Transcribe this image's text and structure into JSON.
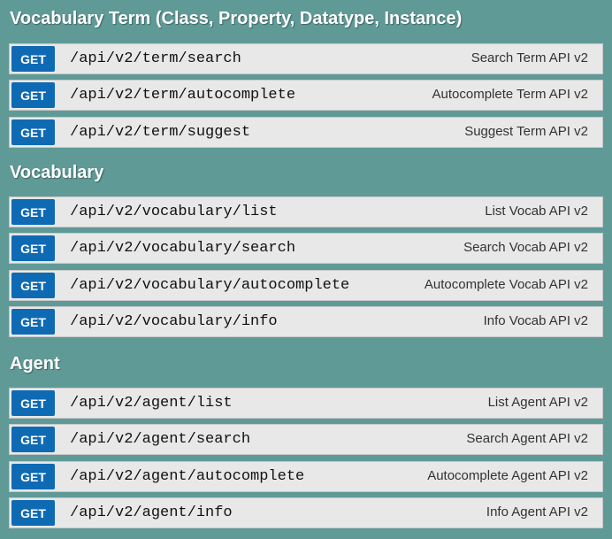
{
  "sections": [
    {
      "title": "Vocabulary Term (Class, Property, Datatype, Instance)",
      "operations": [
        {
          "method": "GET",
          "path": "/api/v2/term/search",
          "summary": "Search Term API v2"
        },
        {
          "method": "GET",
          "path": "/api/v2/term/autocomplete",
          "summary": "Autocomplete Term API v2"
        },
        {
          "method": "GET",
          "path": "/api/v2/term/suggest",
          "summary": "Suggest Term API v2"
        }
      ]
    },
    {
      "title": "Vocabulary",
      "operations": [
        {
          "method": "GET",
          "path": "/api/v2/vocabulary/list",
          "summary": "List Vocab API v2"
        },
        {
          "method": "GET",
          "path": "/api/v2/vocabulary/search",
          "summary": "Search Vocab API v2"
        },
        {
          "method": "GET",
          "path": "/api/v2/vocabulary/autocomplete",
          "summary": "Autocomplete Vocab API v2"
        },
        {
          "method": "GET",
          "path": "/api/v2/vocabulary/info",
          "summary": "Info Vocab API v2"
        }
      ]
    },
    {
      "title": "Agent",
      "operations": [
        {
          "method": "GET",
          "path": "/api/v2/agent/list",
          "summary": "List Agent API v2"
        },
        {
          "method": "GET",
          "path": "/api/v2/agent/search",
          "summary": "Search Agent API v2"
        },
        {
          "method": "GET",
          "path": "/api/v2/agent/autocomplete",
          "summary": "Autocomplete Agent API v2"
        },
        {
          "method": "GET",
          "path": "/api/v2/agent/info",
          "summary": "Info Agent API v2"
        }
      ]
    }
  ],
  "colors": {
    "background": "#5f9a97",
    "get_method": "#0f6ab4",
    "operation_bar": "#e8e8e8"
  }
}
